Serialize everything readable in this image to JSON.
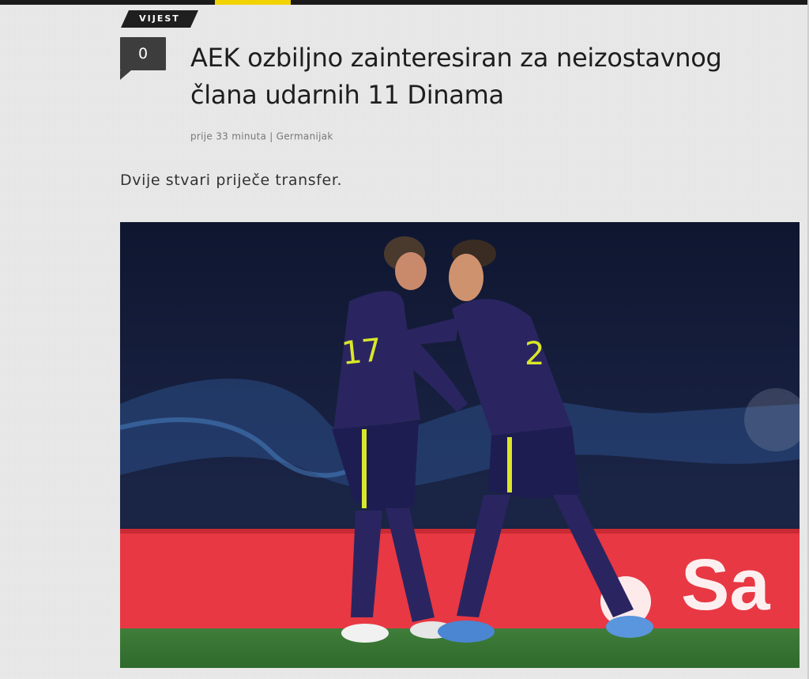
{
  "category": "VIJEST",
  "comments": {
    "count": "0"
  },
  "article": {
    "title": "AEK ozbiljno zainteresiran za neizostavnog člana udarnih 11 Dinama",
    "time": "prije 33 minuta",
    "separator": "|",
    "author": "Germanijak",
    "lead": "Dvije stvari priječe transfer."
  },
  "hero_image": {
    "left_player_number": "17",
    "right_player_number": "2",
    "ad_board_text": "Sa"
  },
  "colors": {
    "accent": "#f2d200",
    "badge": "#3d3d3d",
    "tag": "#1f1f1f",
    "kit": "#2a2560",
    "kit_trim": "#d9e72a"
  },
  "icons": [
    "comment-bubble-icon"
  ]
}
